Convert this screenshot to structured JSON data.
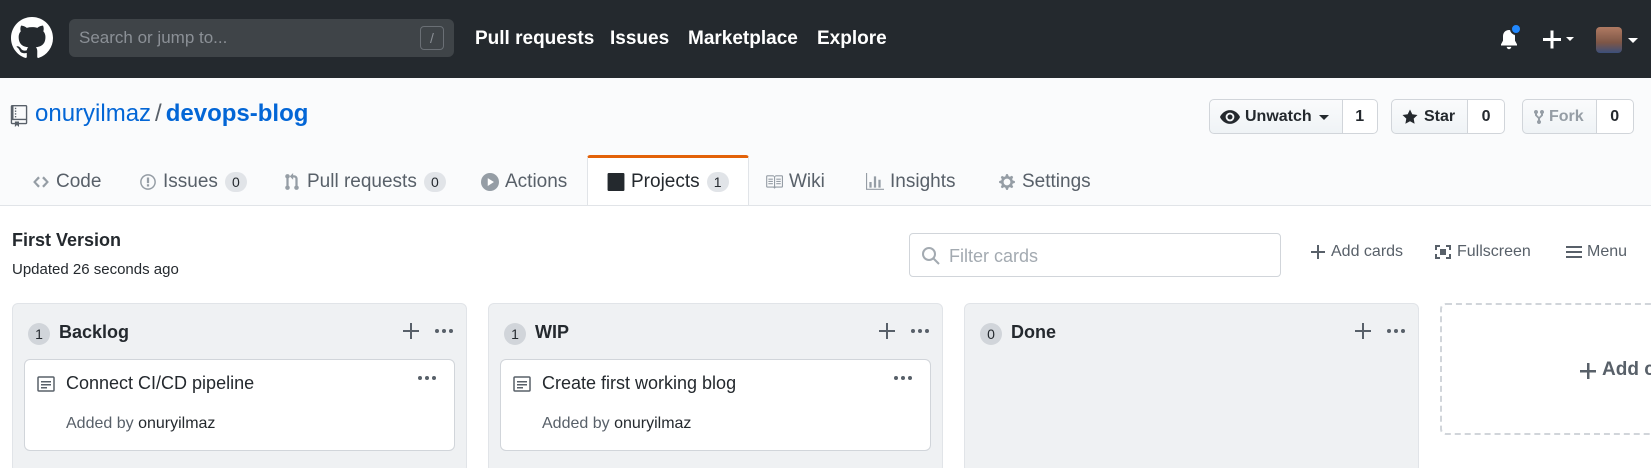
{
  "header": {
    "search_placeholder": "Search or jump to...",
    "search_shortcut": "/",
    "nav": [
      "Pull requests",
      "Issues",
      "Marketplace",
      "Explore"
    ]
  },
  "repo": {
    "owner": "onuryilmaz",
    "separator": "/",
    "name": "devops-blog",
    "watch_label": "Unwatch",
    "watch_count": "1",
    "star_label": "Star",
    "star_count": "0",
    "fork_label": "Fork",
    "fork_count": "0"
  },
  "tabs": [
    {
      "label": "Code",
      "icon": "code-icon"
    },
    {
      "label": "Issues",
      "count": "0",
      "icon": "issue-icon"
    },
    {
      "label": "Pull requests",
      "count": "0",
      "icon": "pull-request-icon"
    },
    {
      "label": "Actions",
      "icon": "play-icon"
    },
    {
      "label": "Projects",
      "count": "1",
      "icon": "project-icon",
      "selected": true
    },
    {
      "label": "Wiki",
      "icon": "book-icon"
    },
    {
      "label": "Insights",
      "icon": "graph-icon"
    },
    {
      "label": "Settings",
      "icon": "gear-icon"
    }
  ],
  "project": {
    "title": "First Version",
    "updated": "Updated 26 seconds ago",
    "filter_placeholder": "Filter cards",
    "add_cards": "Add cards",
    "fullscreen": "Fullscreen",
    "menu": "Menu"
  },
  "columns": [
    {
      "count": "1",
      "name": "Backlog",
      "cards": [
        {
          "title": "Connect CI/CD pipeline",
          "added_by": "Added by",
          "author": "onuryilmaz"
        }
      ]
    },
    {
      "count": "1",
      "name": "WIP",
      "cards": [
        {
          "title": "Create first working blog",
          "added_by": "Added by",
          "author": "onuryilmaz"
        }
      ]
    },
    {
      "count": "0",
      "name": "Done",
      "cards": []
    }
  ],
  "add_column_label": "Add c",
  "colors": {
    "header_bg": "#24292e",
    "link_blue": "#0366d6",
    "selected_tab_accent": "#e36209",
    "notification_dot": "#2188ff"
  }
}
